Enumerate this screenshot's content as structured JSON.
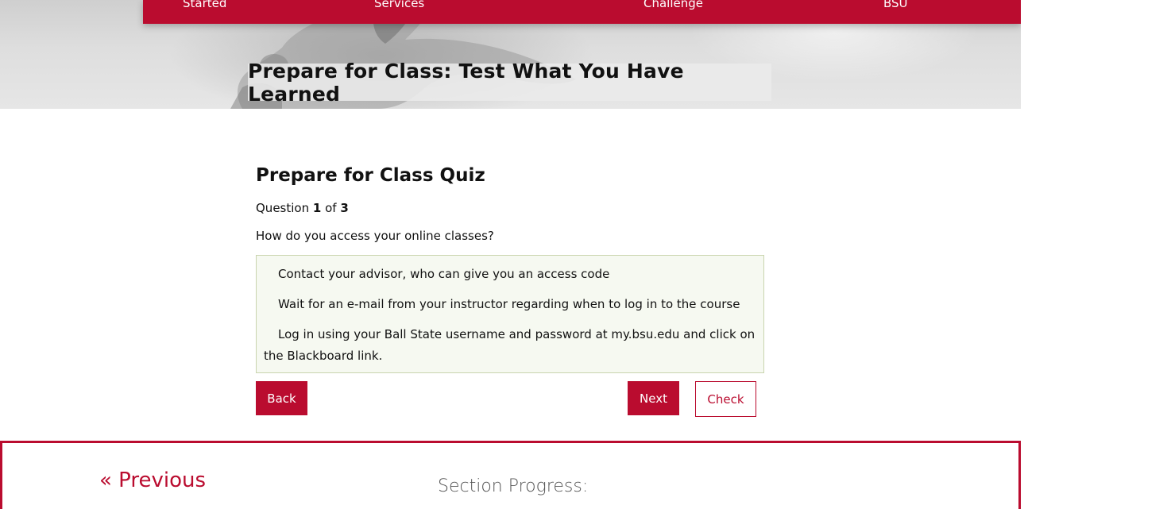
{
  "nav": {
    "items": [
      {
        "label": "Started"
      },
      {
        "label": "Services"
      },
      {
        "label": "Challenge"
      },
      {
        "label": "BSU"
      }
    ]
  },
  "hero": {
    "title": "Prepare for Class: Test What You Have Learned"
  },
  "quiz": {
    "title": "Prepare for Class Quiz",
    "counter": {
      "prefix": "Question",
      "current": "1",
      "of": "of",
      "total": "3"
    },
    "question": "How do you access your online classes?",
    "answers": [
      "Contact your advisor, who can give you an access code",
      "Wait for an e-mail from your instructor regarding when to log in to the course",
      "Log in using your Ball State username and password at my.bsu.edu and click on the Blackboard link."
    ],
    "buttons": {
      "back": "Back",
      "next": "Next",
      "check": "Check"
    }
  },
  "footer": {
    "previous": "« Previous",
    "section_progress": "Section Progress:"
  },
  "colors": {
    "accent": "#ba0c2f",
    "answers_bg": "#f6f9f1",
    "answers_border": "#c9d5ae"
  }
}
